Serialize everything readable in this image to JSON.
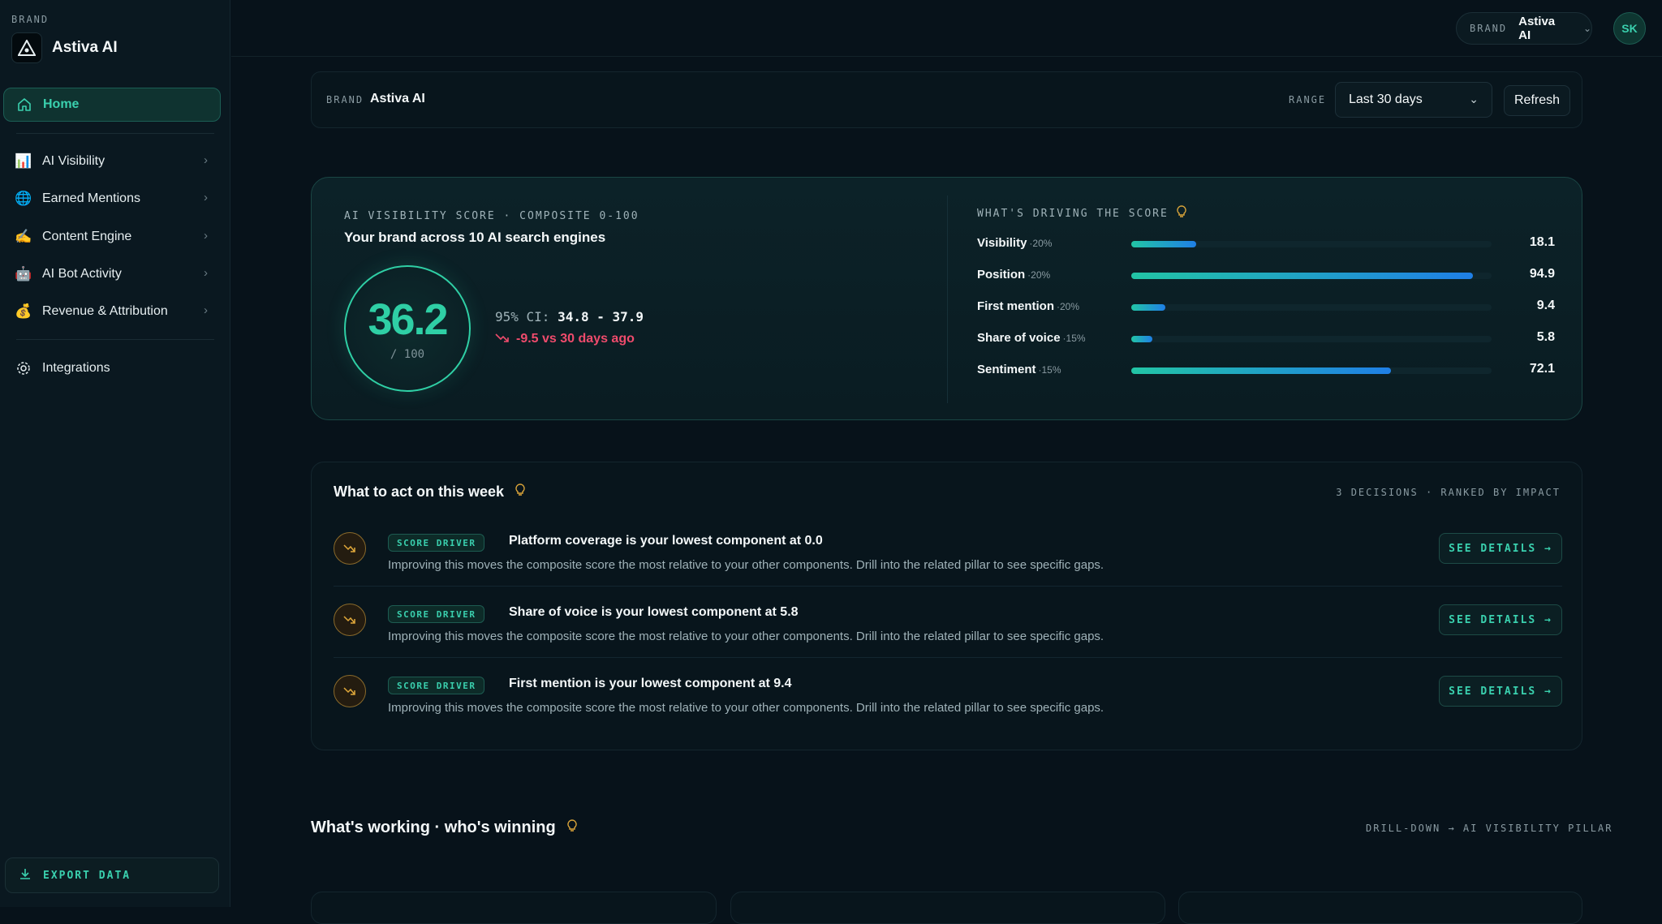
{
  "sidebar": {
    "brand_label": "BRAND",
    "brand_name": "Astiva AI",
    "home_label": "Home",
    "items": [
      {
        "label": "AI Visibility",
        "icon": "bar-chart-icon"
      },
      {
        "label": "Earned Mentions",
        "icon": "globe-icon"
      },
      {
        "label": "Content Engine",
        "icon": "pen-icon"
      },
      {
        "label": "AI Bot Activity",
        "icon": "robot-icon"
      },
      {
        "label": "Revenue & Attribution",
        "icon": "money-bag-icon"
      }
    ],
    "integrations_label": "Integrations",
    "export_label": "EXPORT DATA"
  },
  "topbar": {
    "brand_label": "BRAND",
    "brand_value": "Astiva AI",
    "avatar_initials": "SK"
  },
  "filters": {
    "brand_label": "BRAND",
    "brand_value": "Astiva AI",
    "range_label": "RANGE",
    "range_value": "Last 30 days",
    "refresh_label": "Refresh"
  },
  "score": {
    "eyebrow": "AI VISIBILITY SCORE · COMPOSITE 0-100",
    "title": "Your brand across 10 AI search engines",
    "value": "36.2",
    "out_of": "/ 100",
    "ci_label": "95% CI:",
    "ci_value": "34.8 - 37.9",
    "delta": "-9.5 vs 30 days ago",
    "drivers_eyebrow": "WHAT'S DRIVING THE SCORE",
    "drivers": [
      {
        "name": "Visibility",
        "weight": "·20%",
        "value": "18.1",
        "fill": 18.1
      },
      {
        "name": "Position",
        "weight": "·20%",
        "value": "94.9",
        "fill": 94.9
      },
      {
        "name": "First mention",
        "weight": "·20%",
        "value": "9.4",
        "fill": 9.4
      },
      {
        "name": "Share of voice",
        "weight": "·15%",
        "value": "5.8",
        "fill": 5.8
      },
      {
        "name": "Sentiment",
        "weight": "·15%",
        "value": "72.1",
        "fill": 72.1
      }
    ]
  },
  "actions": {
    "title": "What to act on this week",
    "meta": "3 DECISIONS · RANKED BY IMPACT",
    "items": [
      {
        "badge": "SCORE DRIVER",
        "headline": "Platform coverage is your lowest component at 0.0",
        "description": "Improving this moves the composite score the most relative to your other components. Drill into the related pillar to see specific gaps.",
        "cta": "SEE DETAILS →"
      },
      {
        "badge": "SCORE DRIVER",
        "headline": "Share of voice is your lowest component at 5.8",
        "description": "Improving this moves the composite score the most relative to your other components. Drill into the related pillar to see specific gaps.",
        "cta": "SEE DETAILS →"
      },
      {
        "badge": "SCORE DRIVER",
        "headline": "First mention is your lowest component at 9.4",
        "description": "Improving this moves the composite score the most relative to your other components. Drill into the related pillar to see specific gaps.",
        "cta": "SEE DETAILS →"
      }
    ]
  },
  "working": {
    "title": "What's working · who's winning",
    "meta": "DRILL-DOWN → AI VISIBILITY PILLAR"
  },
  "colors": {
    "accent": "#2fcfa5",
    "negative": "#ef4b6c",
    "background": "#07121a"
  }
}
